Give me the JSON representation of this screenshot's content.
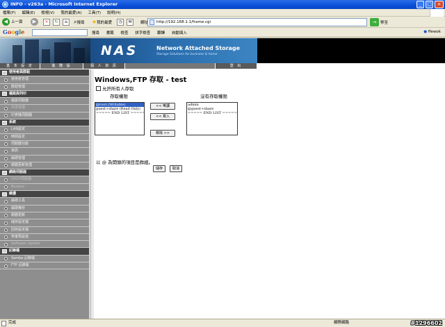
{
  "window": {
    "title": "INFO - v263a - Microsoft Internet Explorer"
  },
  "menu": [
    "檔案(F)",
    "編輯(E)",
    "檢視(V)",
    "我的最愛(A)",
    "工具(T)",
    "說明(H)"
  ],
  "toolbar": {
    "back_label": "上一頁",
    "search_label": "搜尋",
    "favorites_label": "我的最愛",
    "address_label": "網址",
    "address": "http://192.168.1.1/frame.cgi",
    "go_label": "移至",
    "links": "連結  零一月的部落~ · 巴哈姆特電玩資訊站"
  },
  "google_bar": {
    "logo": "Google",
    "items": [
      "搜尋",
      "書籤",
      "檢查",
      "拼字檢查",
      "翻譯",
      "自動填入"
    ],
    "account": "ffewok"
  },
  "banner": {
    "logo": "NAS",
    "title": "Network Attached Storage",
    "subtitle": "Storage Solutions for business & home"
  },
  "tabs": [
    "基 本 設 定",
    "進 階 設",
    "個 人 資 訊",
    "登 出"
  ],
  "sidebar": {
    "items": [
      {
        "label": "使用者與群組",
        "type": "group"
      },
      {
        "label": "使用者管理",
        "type": "item"
      },
      {
        "label": "群組管理",
        "type": "item"
      },
      {
        "label": "檔案與列印",
        "type": "group"
      },
      {
        "label": "檔案伺服器",
        "type": "item"
      },
      {
        "label": "共享管理",
        "type": "item",
        "disabled": true
      },
      {
        "label": "印表機伺服器",
        "type": "item"
      },
      {
        "label": "系統",
        "type": "group"
      },
      {
        "label": "LAN設定",
        "type": "item"
      },
      {
        "label": "時間設定",
        "type": "item"
      },
      {
        "label": "伺服器功能",
        "type": "item"
      },
      {
        "label": "資訊",
        "type": "item"
      },
      {
        "label": "磁碟管理",
        "type": "item"
      },
      {
        "label": "韌體更新管理",
        "type": "item"
      },
      {
        "label": "網路伺服器",
        "type": "group"
      },
      {
        "label": "DHCP伺服器",
        "type": "item",
        "disabled": true
      },
      {
        "label": "Bonjour",
        "type": "item",
        "disabled": true
      },
      {
        "label": "維護",
        "type": "group"
      },
      {
        "label": "磁碟工具",
        "type": "item"
      },
      {
        "label": "磁碟備份",
        "type": "item"
      },
      {
        "label": "韌體更新",
        "type": "item"
      },
      {
        "label": "儲存設定檔",
        "type": "item"
      },
      {
        "label": "回存設定檔",
        "type": "item"
      },
      {
        "label": "恢復預設值",
        "type": "item"
      },
      {
        "label": "Software Update",
        "type": "item",
        "disabled": true
      },
      {
        "label": "記錄檔",
        "type": "group"
      },
      {
        "label": "Samba 記錄檔",
        "type": "item"
      },
      {
        "label": "FTP 記錄檔",
        "type": "item"
      }
    ]
  },
  "content": {
    "heading": "Windows,FTP 存取 - test",
    "allow_all_label": "允許所有人存取",
    "access_label": "存取權限",
    "no_access_label": "沒有存取權限",
    "access_list": [
      "@root (Writable)",
      "guest+share (Read Only)",
      "===== END LIST ====="
    ],
    "no_access_list": [
      "admin",
      "@guest+share",
      "===== END LIST ====="
    ],
    "btn_readwrite": "<< 唯讀",
    "btn_write": "<< 寫入",
    "btn_remove": "移除 >>",
    "note": "以 @ 為開頭的項目是群組。",
    "save_label": "儲存",
    "cancel_label": "取消"
  },
  "status": {
    "done": "完成",
    "zone": "網際網路",
    "watermark": "#1296602"
  }
}
